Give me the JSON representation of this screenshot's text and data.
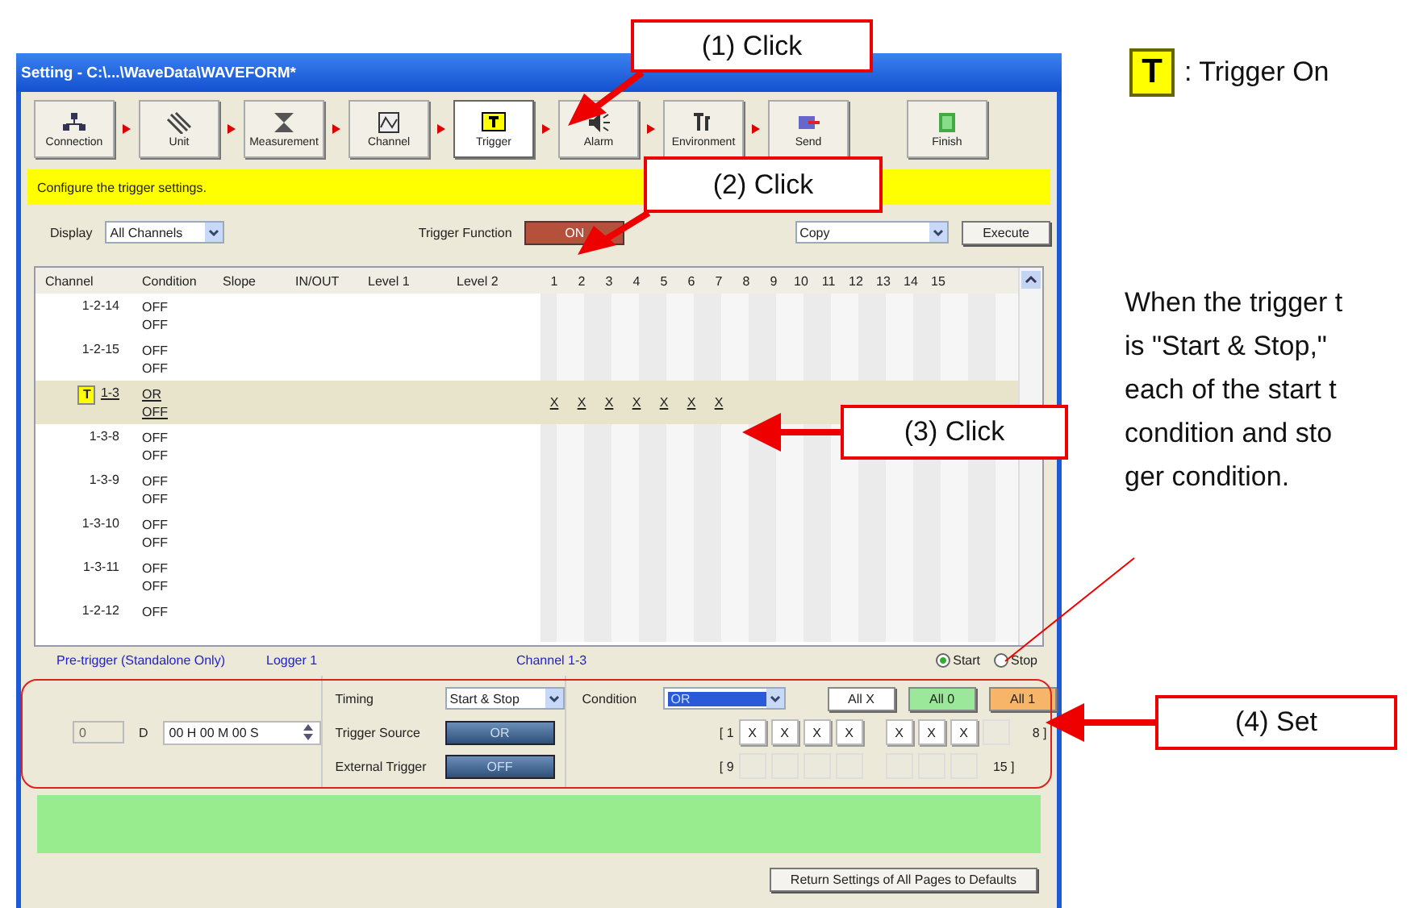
{
  "window": {
    "title": "Setting - C:\\...\\WaveData\\WAVEFORM*"
  },
  "steps": [
    {
      "label": "Connection",
      "selected": false
    },
    {
      "label": "Unit",
      "selected": false
    },
    {
      "label": "Measurement",
      "selected": false
    },
    {
      "label": "Channel",
      "selected": false
    },
    {
      "label": "Trigger",
      "selected": true
    },
    {
      "label": "Alarm",
      "selected": false
    },
    {
      "label": "Environment",
      "selected": false
    },
    {
      "label": "Send",
      "selected": false
    },
    {
      "label": "Finish",
      "selected": false
    }
  ],
  "prompt": "Configure the trigger settings.",
  "display": {
    "label": "Display",
    "value": "All Channels"
  },
  "trigger_function": {
    "label": "Trigger Function",
    "value": "ON",
    "on": true
  },
  "copy": {
    "value": "Copy",
    "button": "Execute"
  },
  "table": {
    "columns": [
      "Channel",
      "Condition",
      "Slope",
      "IN/OUT",
      "Level 1",
      "Level 2"
    ],
    "bit_columns": [
      "1",
      "2",
      "3",
      "4",
      "5",
      "6",
      "7",
      "8",
      "9",
      "10",
      "11",
      "12",
      "13",
      "14",
      "15"
    ],
    "rows": [
      {
        "channel": "1-2-14",
        "conditions": [
          "OFF",
          "OFF"
        ],
        "trigger": false,
        "selected": false,
        "bits": []
      },
      {
        "channel": "1-2-15",
        "conditions": [
          "OFF",
          "OFF"
        ],
        "trigger": false,
        "selected": false,
        "bits": []
      },
      {
        "channel": "1-3",
        "conditions": [
          "OR",
          "OFF"
        ],
        "trigger": true,
        "trigger_mark": "T",
        "selected": true,
        "bits": [
          "X",
          "X",
          "X",
          "X",
          "X",
          "X",
          "X"
        ]
      },
      {
        "channel": "1-3-8",
        "conditions": [
          "OFF",
          "OFF"
        ],
        "trigger": false,
        "selected": false,
        "bits": []
      },
      {
        "channel": "1-3-9",
        "conditions": [
          "OFF",
          "OFF"
        ],
        "trigger": false,
        "selected": false,
        "bits": []
      },
      {
        "channel": "1-3-10",
        "conditions": [
          "OFF",
          "OFF"
        ],
        "trigger": false,
        "selected": false,
        "bits": []
      },
      {
        "channel": "1-3-11",
        "conditions": [
          "OFF",
          "OFF"
        ],
        "trigger": false,
        "selected": false,
        "bits": []
      },
      {
        "channel": "1-2-12",
        "conditions": [
          "OFF"
        ],
        "trigger": false,
        "selected": false,
        "bits": []
      }
    ]
  },
  "sections": [
    "Pre-trigger (Standalone Only)",
    "Logger 1",
    "Channel 1-3"
  ],
  "start_stop": [
    {
      "label": "Start",
      "selected": true
    },
    {
      "label": "Stop",
      "selected": false
    }
  ],
  "pretrigger": {
    "count": "0",
    "unit": "D",
    "time": "00 H 00 M 00 S"
  },
  "timing": {
    "label": "Timing",
    "value": "Start & Stop"
  },
  "trigger_source": {
    "label": "Trigger Source",
    "value": "OR"
  },
  "external_trigger": {
    "label": "External Trigger",
    "value": "OFF"
  },
  "condition": {
    "label": "Condition",
    "value": "OR",
    "buttons": [
      {
        "label": "All X",
        "kind": "x"
      },
      {
        "label": "All 0",
        "kind": "zero"
      },
      {
        "label": "All 1",
        "kind": "one"
      }
    ]
  },
  "bit_rows": [
    {
      "start": "[ 1",
      "end": "8 ]",
      "cells": [
        {
          "value": "X",
          "disabled": false
        },
        {
          "value": "X",
          "disabled": false
        },
        {
          "value": "X",
          "disabled": false
        },
        {
          "value": "X",
          "disabled": false
        },
        {
          "value": "X",
          "disabled": false
        },
        {
          "value": "X",
          "disabled": false
        },
        {
          "value": "X",
          "disabled": false
        },
        {
          "disabled": true
        }
      ]
    },
    {
      "start": "[ 9",
      "end": "15 ]",
      "cells": [
        {
          "disabled": true
        },
        {
          "disabled": true
        },
        {
          "disabled": true
        },
        {
          "disabled": true
        },
        {
          "disabled": true
        },
        {
          "disabled": true
        },
        {
          "disabled": true
        }
      ]
    }
  ],
  "return_button": "Return Settings of All Pages to Defaults",
  "callouts": [
    "(1) Click",
    "(2) Click",
    "(3) Click",
    "(4) Set"
  ],
  "legend": {
    "mark": "T",
    "text": ": Trigger On"
  },
  "note": [
    "When the trigger t",
    "is \"Start & Stop,\"",
    "each of the start t",
    "condition and sto",
    "ger condition."
  ]
}
